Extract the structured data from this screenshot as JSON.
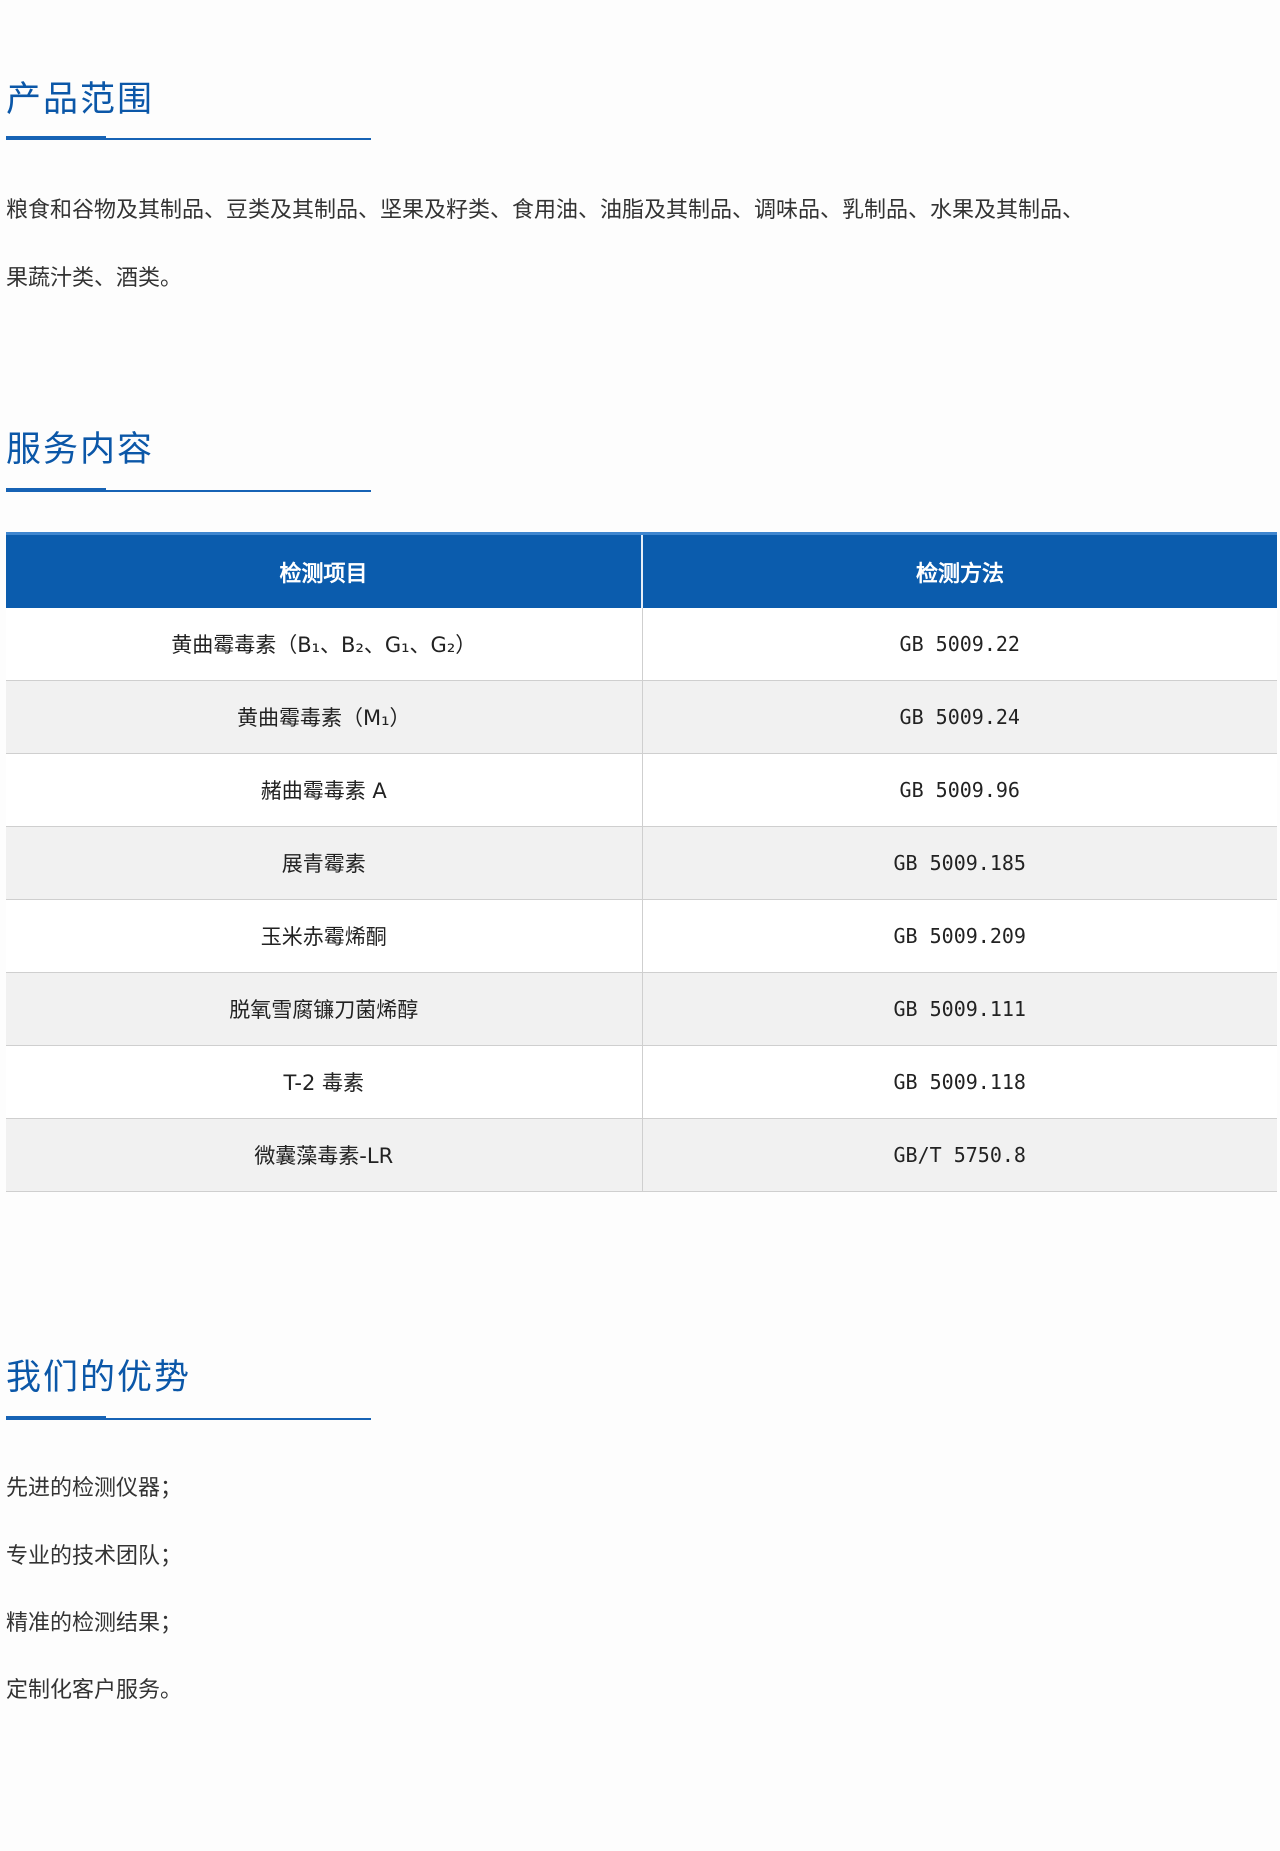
{
  "sections": {
    "product_range": {
      "title": "产品范围",
      "lines": [
        "粮食和谷物及其制品、豆类及其制品、坚果及籽类、食用油、油脂及其制品、调味品、乳制品、水果及其制品、",
        "果蔬汁类、酒类。"
      ]
    },
    "service": {
      "title": "服务内容",
      "table": {
        "headers": [
          "检测项目",
          "检测方法"
        ],
        "rows": [
          {
            "item": "黄曲霉毒素（B₁、B₂、G₁、G₂）",
            "method": "GB 5009.22"
          },
          {
            "item": "黄曲霉毒素（M₁）",
            "method": "GB 5009.24"
          },
          {
            "item": "赭曲霉毒素 A",
            "method": "GB 5009.96"
          },
          {
            "item": "展青霉素",
            "method": "GB 5009.185"
          },
          {
            "item": "玉米赤霉烯酮",
            "method": "GB 5009.209"
          },
          {
            "item": "脱氧雪腐镰刀菌烯醇",
            "method": "GB 5009.111"
          },
          {
            "item": "T-2 毒素",
            "method": "GB 5009.118"
          },
          {
            "item": "微囊藻毒素-LR",
            "method": "GB/T 5750.8"
          }
        ]
      }
    },
    "advantages": {
      "title": "我们的优势",
      "items": [
        "先进的检测仪器；",
        "专业的技术团队；",
        "精准的检测结果；",
        "定制化客户服务。"
      ]
    }
  },
  "colors": {
    "heading": "#0b57a8",
    "table_header_bg": "#0b5cad",
    "row_stripe": "#f1f1f1"
  }
}
